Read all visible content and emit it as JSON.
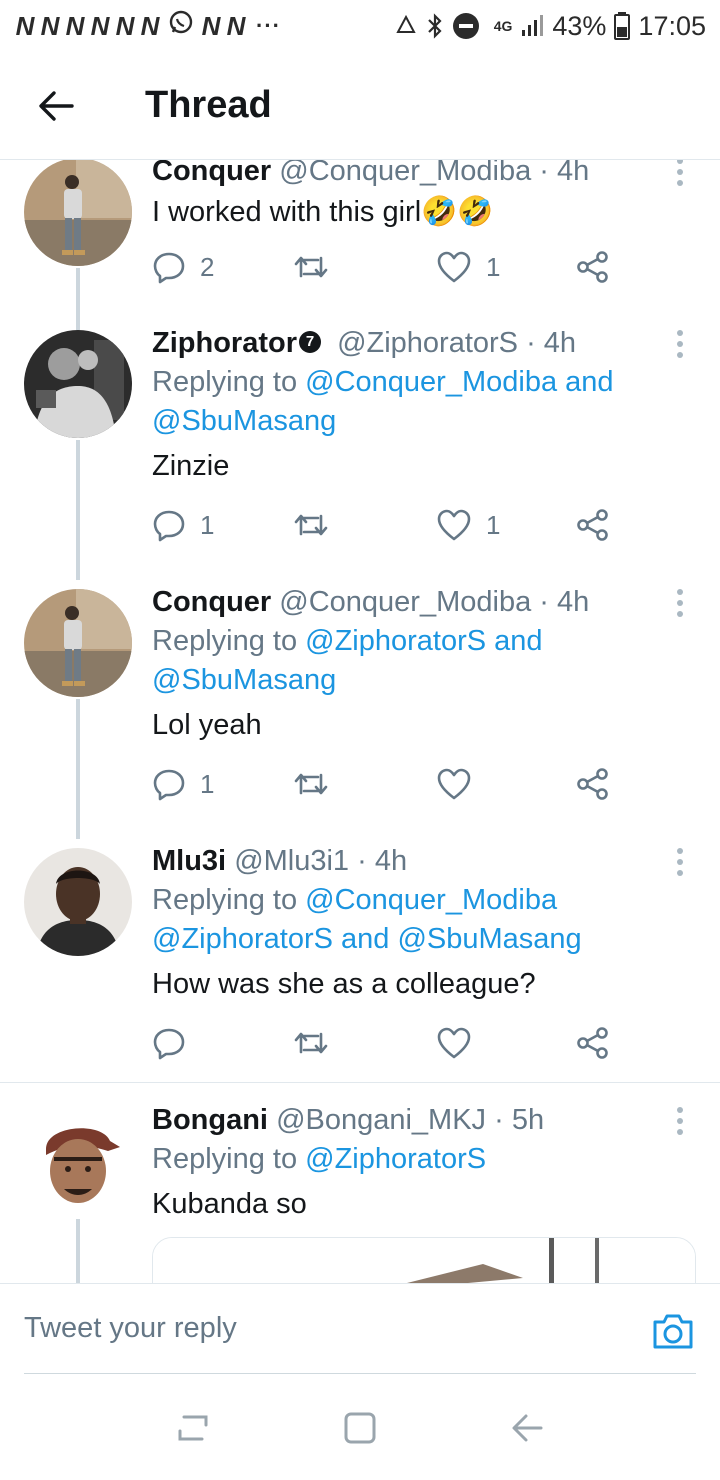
{
  "status_bar": {
    "notifications": [
      "N",
      "N",
      "N",
      "N",
      "N",
      "N",
      "N",
      "N"
    ],
    "more_indicator": "···",
    "network": "4G",
    "battery": "43%",
    "time": "17:05"
  },
  "header": {
    "title": "Thread"
  },
  "tweets": [
    {
      "name": "Conquer",
      "handle": "@Conquer_Modiba",
      "time": "· 4h",
      "text": "I worked with this girl🤣🤣",
      "replies": "2",
      "retweets": "",
      "likes": "1"
    },
    {
      "name": "Ziphorator",
      "badge": "7",
      "handle": "@ZiphoratorS",
      "time": "· 4h",
      "reply_prefix": "Replying to ",
      "reply_line1": "@Conquer_Modiba and",
      "reply_line2": "@SbuMasang",
      "text": "Zinzie",
      "replies": "1",
      "retweets": "",
      "likes": "1"
    },
    {
      "name": "Conquer",
      "handle": "@Conquer_Modiba",
      "time": "· 4h",
      "reply_prefix": "Replying to ",
      "reply_line1": "@ZiphoratorS and",
      "reply_line2": "@SbuMasang",
      "text": "Lol yeah",
      "replies": "1",
      "retweets": "",
      "likes": ""
    },
    {
      "name": "Mlu3i",
      "handle": "@Mlu3i1",
      "time": "· 4h",
      "reply_prefix": "Replying to ",
      "reply_line1": "@Conquer_Modiba",
      "reply_line2": "@ZiphoratorS and @SbuMasang",
      "text": "How was she as a colleague?",
      "replies": "",
      "retweets": "",
      "likes": ""
    },
    {
      "name": "Bongani",
      "handle": "@Bongani_MKJ",
      "time": "· 5h",
      "reply_prefix": "Replying to ",
      "reply_line1": "@ZiphoratorS",
      "text": "Kubanda so"
    }
  ],
  "reply_bar": {
    "placeholder": "Tweet your reply"
  },
  "colors": {
    "link": "#1b95e0",
    "muted": "#657786",
    "text": "#14171a",
    "line": "#ccd6dd"
  }
}
